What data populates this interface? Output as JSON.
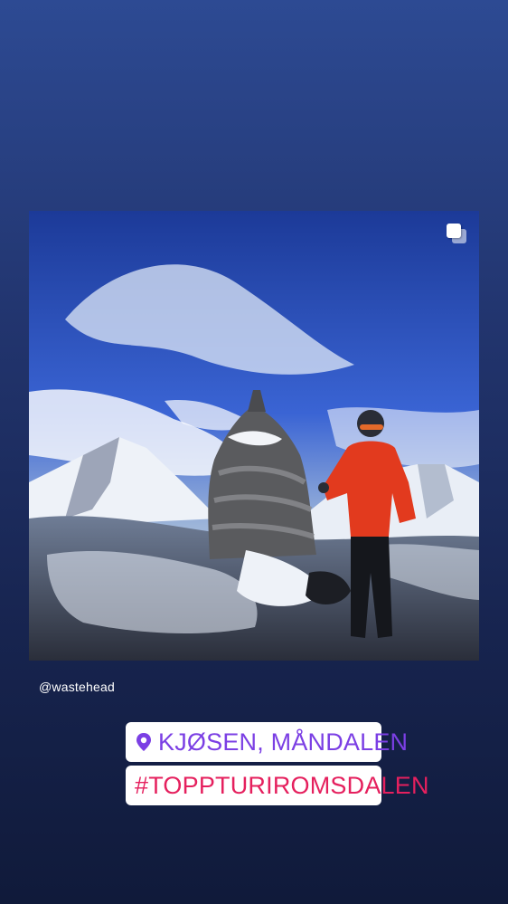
{
  "post": {
    "credit": "@wastehead",
    "photo_alt_icon": "multiple-photos-icon"
  },
  "stickers": {
    "location": {
      "icon": "location-pin-icon",
      "text": "KJØSEN, MÅNDALEN",
      "color": "#7b3fe4"
    },
    "hashtag": {
      "text": "#TOPPTURIROMSDALEN",
      "color": "#e5205e"
    }
  }
}
